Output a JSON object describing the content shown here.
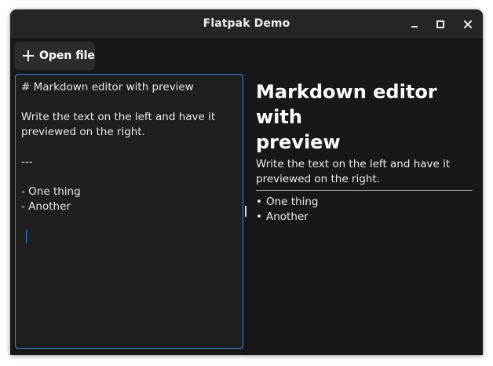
{
  "window": {
    "title": "Flatpak Demo",
    "controls": [
      "minimize-icon",
      "maximize-icon",
      "close-icon"
    ]
  },
  "toolbar": {
    "open_icon": "plus-icon",
    "open_label": "Open file"
  },
  "editor": {
    "lines": [
      "# Markdown editor with preview",
      "",
      "Write the text on the left and have it",
      "previewed on the right.",
      "",
      "---",
      "",
      "- One thing",
      "- Another",
      "",
      ""
    ]
  },
  "preview": {
    "heading_line1": "Markdown editor with",
    "heading_line2": "preview",
    "paragraph_line1": "Write the text on the left and have it",
    "paragraph_line2": "previewed on the right.",
    "list_items": [
      "One thing",
      "Another"
    ],
    "bullet": "•"
  },
  "colors": {
    "accent": "#3584e4",
    "window_bg": "#181818",
    "headerbar_bg": "#262626",
    "editor_bg": "#1f1f1f",
    "button_bg": "#2c2c2c"
  }
}
